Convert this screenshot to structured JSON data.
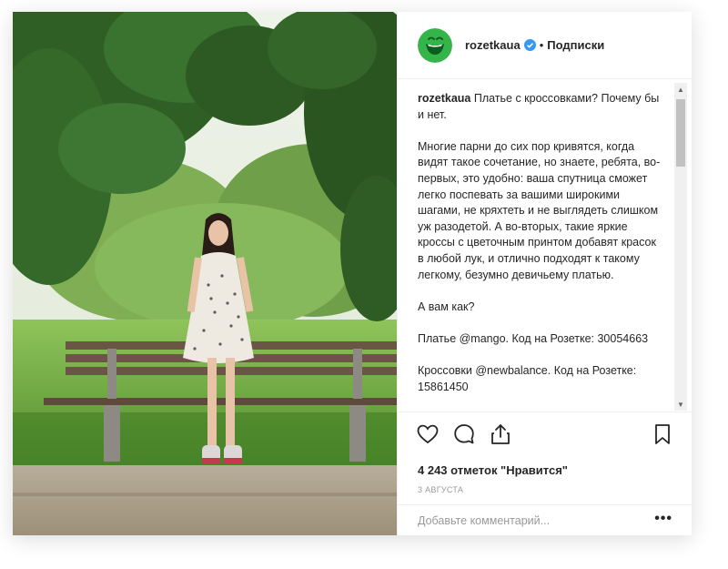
{
  "post": {
    "username": "rozetkaua",
    "separator": "•",
    "follow_label": "Подписки",
    "caption_user": "rozetkaua",
    "caption_first": "Платье с кроссовками? Почему бы и нет.",
    "caption_para2": "Многие парни до сих пор кривятся, когда видят такое сочетание, но знаете, ребята, во-первых, это удобно: ваша спутница сможет легко поспевать за вашими широкими шагами, не кряхтеть и не выглядеть слишком уж разодетой. А во-вторых, такие яркие кроссы с цветочным принтом добавят красок в любой лук, и отлично подходят к такому легкому, безумно девичьему платью.",
    "caption_para3": "А вам как?",
    "caption_para4": "Платье @mango. Код на Розетке: 30054663",
    "caption_para5": "Кроссовки @newbalance. Код на Розетке: 15861450",
    "likes": "4 243 отметок \"Нравится\"",
    "date": "3 АВГУСТА",
    "comment_placeholder": "Добавьте комментарий...",
    "more_label": "•••"
  },
  "icons": {
    "like": "heart-icon",
    "comment": "comment-bubble-icon",
    "share": "share-icon",
    "save": "bookmark-icon",
    "verified": "verified-badge-icon"
  },
  "colors": {
    "avatar_green": "#35b44a",
    "verified_blue": "#3897f0"
  }
}
